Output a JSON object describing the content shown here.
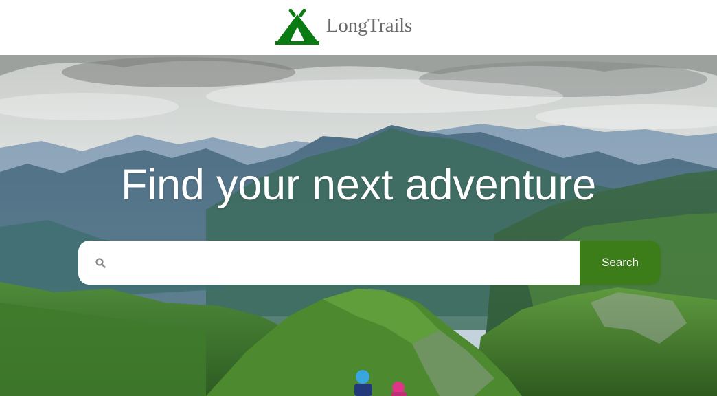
{
  "header": {
    "brand_name": "LongTrails",
    "logo_icon": "tent-icon",
    "brand_color": "#0a7a13"
  },
  "hero": {
    "title": "Find your next adventure",
    "background": "mountain-landscape-with-hikers"
  },
  "search": {
    "placeholder": "",
    "value": "",
    "icon": "search-icon",
    "button_label": "Search",
    "button_color": "#3c7d1a"
  }
}
